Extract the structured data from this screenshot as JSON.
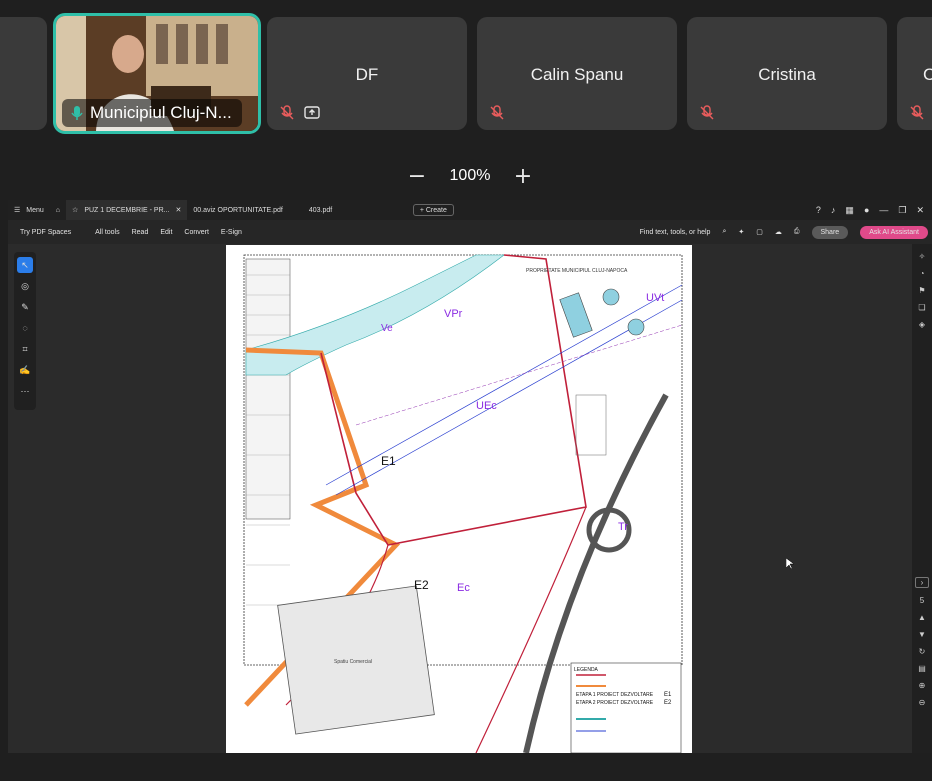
{
  "participants": [
    {
      "name": "",
      "muted": false
    },
    {
      "name": "Municipiul Cluj-N...",
      "active": true
    },
    {
      "name": "DF",
      "muted": true,
      "sharing": true
    },
    {
      "name": "Calin Spanu",
      "muted": true
    },
    {
      "name": "Cristina",
      "muted": true
    },
    {
      "name": "C",
      "muted": true
    }
  ],
  "zoom": {
    "minus": "−",
    "value": "100%",
    "plus": "+"
  },
  "pdf": {
    "menu": "Menu",
    "tabs": [
      "PUZ 1 DECEMBRIE - PR...",
      "00.aviz OPORTUNITATE.pdf",
      "403.pdf"
    ],
    "create": "+ Create",
    "tools": [
      "Try PDF Spaces",
      "All tools",
      "Read",
      "Edit",
      "Convert",
      "E-Sign"
    ],
    "find": "Find text, tools, or help",
    "share": "Share",
    "assistant": "Ask AI Assistant",
    "page_number": "5",
    "map_labels": {
      "ve": "Ve",
      "vpr": "VPr",
      "uvt": "UVt",
      "uec": "UEc",
      "e1": "E1",
      "e2": "E2",
      "ec": "Ec",
      "tr": "Tr",
      "owner": "PROPRIETATE MUNICIPIUL CLUJ-NAPOCA",
      "legend_title": "LEGENDA",
      "etapa1": "ETAPA 1 PROIECT DEZVOLTARE",
      "etapa2": "ETAPA 2 PROIECT DEZVOLTARE",
      "e1_code": "E1",
      "e2_code": "E2",
      "commercial": "Spatiu Comercial"
    }
  },
  "colors": {
    "active_border": "#2fbfa8",
    "share_button": "#5a5a5a",
    "assistant_button": "#e04a8a"
  }
}
